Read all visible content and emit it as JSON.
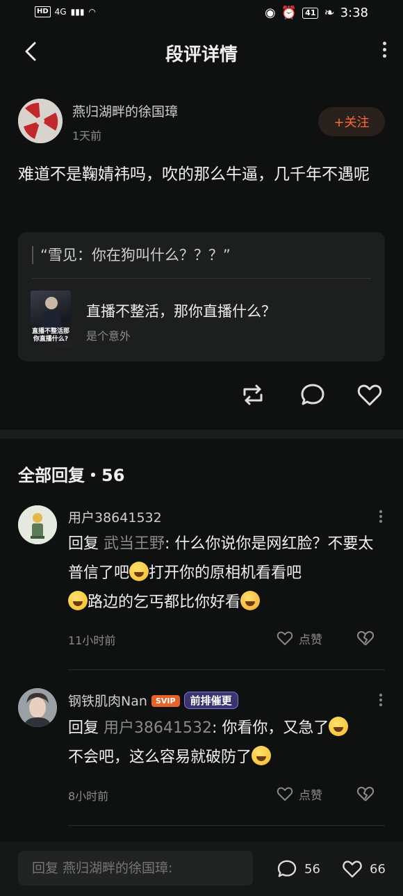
{
  "status_bar": {
    "network": "4G",
    "time": "3:38",
    "battery": "41"
  },
  "header": {
    "title": "段评详情"
  },
  "post": {
    "author": "燕归湖畔的徐国璋",
    "time": "1天前",
    "follow_label": "+关注",
    "text": "难道不是鞠婧祎吗，吹的那么牛逼，几千年不遇呢",
    "quote": "“雪见：你在狗叫什么？？？”",
    "book": {
      "title": "直播不整活，那你直播什么？",
      "author": "是个意外",
      "cover_text": "直播不整活那你直播什么?"
    }
  },
  "replies": {
    "heading": "全部回复・56",
    "items": [
      {
        "user": "用户38641532",
        "reply_prefix": "回复 ",
        "reply_to": "武当王野",
        "text1": ": 什么你说你是网红脸？不要太普信了吧",
        "text2": "打开你的原相机看看吧",
        "text3": "路边的乞丐都比你好看",
        "time": "11小时前",
        "like_label": "点赞"
      },
      {
        "user": "钢铁肌肉Nan",
        "vip": "SVIP",
        "badge": "前排催更",
        "reply_prefix": "回复 ",
        "reply_to": "用户38641532",
        "text1": ": 你看你，又急了",
        "text2": "不会吧，这么容易就破防了",
        "time": "8小时前",
        "like_label": "点赞"
      }
    ]
  },
  "bottom_bar": {
    "placeholder": "回复 燕归湖畔的徐国璋:",
    "comment_count": "56",
    "like_count": "66"
  },
  "colors": {
    "accent": "#ff6a33",
    "background": "#0f1110"
  }
}
